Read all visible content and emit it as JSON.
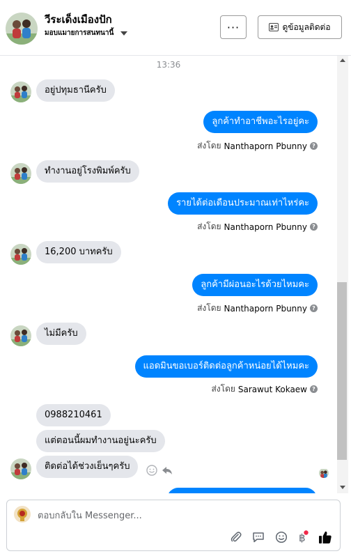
{
  "header": {
    "title": "วีระเด็งเมืองปัก",
    "subtitle": "มอบแมายการสนทนานี้",
    "more_label": "···",
    "info_label": "ดูข้อมูลติดต่อ"
  },
  "thread": {
    "timestamp": "13:36",
    "sent_by_prefix": "ส่งโดย",
    "messages": [
      {
        "dir": "in",
        "text": "อยู่ปทุมธานีครับ"
      },
      {
        "dir": "out",
        "text": "ลูกค้าทำอาชีพอะไรอยู่คะ",
        "sender": "Nanthaporn Pbunny"
      },
      {
        "dir": "in",
        "text": "ทำงานอยู่โรงพิมพ์ครับ"
      },
      {
        "dir": "out",
        "text": "รายได้ต่อเดือนประมาณเท่าไหร่คะ",
        "sender": "Nanthaporn Pbunny"
      },
      {
        "dir": "in",
        "text": "16,200 บาทครับ"
      },
      {
        "dir": "out",
        "text": "ลูกค้ามีผ่อนอะไรด้วยไหมคะ",
        "sender": "Nanthaporn Pbunny"
      },
      {
        "dir": "in",
        "text": "ไม่มีครับ"
      },
      {
        "dir": "out",
        "text": "แอดมินขอเบอร์ติดต่อลูกค้าหน่อยได้ไหมคะ",
        "sender": "Sarawut Kokaew"
      },
      {
        "dir": "in",
        "text": "0988210461"
      },
      {
        "dir": "in",
        "text": "แต่ตอนนี้ผมทำงานอยู่นะครับ"
      },
      {
        "dir": "in",
        "text": "ติดต่อได้ช่วงเย็นๆครับ"
      }
    ]
  },
  "reply": {
    "placeholder": "ตอบกลับใน Messenger..."
  },
  "colors": {
    "outgoing": "#0084ff",
    "incoming": "#e4e6eb",
    "like": "#050505"
  },
  "icons": [
    "more-icon",
    "contact-card-icon",
    "attach-icon",
    "saved-reply-icon",
    "emoji-icon",
    "baht-icon",
    "like-icon",
    "reaction-icon",
    "reply-icon"
  ]
}
